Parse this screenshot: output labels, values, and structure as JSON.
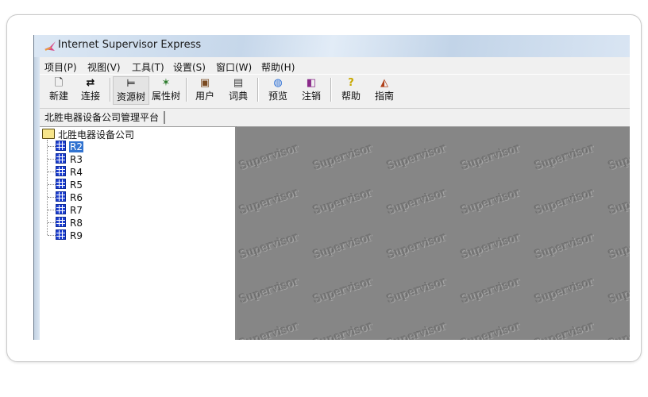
{
  "window": {
    "title": "Internet Supervisor Express"
  },
  "menu": [
    {
      "label": "项目(P)"
    },
    {
      "label": "视图(V)"
    },
    {
      "label": "工具(T)"
    },
    {
      "label": "设置(S)"
    },
    {
      "label": "窗口(W)"
    },
    {
      "label": "帮助(H)"
    }
  ],
  "toolbar": [
    {
      "label": "新建",
      "icon": "new-document-icon",
      "glyph": "🗋"
    },
    {
      "label": "连接",
      "icon": "connect-icon",
      "glyph": "⇄"
    },
    {
      "label": "资源树",
      "icon": "resource-tree-icon",
      "glyph": "⊨"
    },
    {
      "label": "属性树",
      "icon": "property-tree-icon",
      "glyph": "✶"
    },
    {
      "label": "用户",
      "icon": "user-icon",
      "glyph": "▣"
    },
    {
      "label": "词典",
      "icon": "dictionary-icon",
      "glyph": "▤"
    },
    {
      "label": "预览",
      "icon": "preview-icon",
      "glyph": "◍"
    },
    {
      "label": "注销",
      "icon": "logout-icon",
      "glyph": "◧"
    },
    {
      "label": "帮助",
      "icon": "help-icon",
      "glyph": "?"
    },
    {
      "label": "指南",
      "icon": "guide-icon",
      "glyph": "◭"
    }
  ],
  "tabs": [
    {
      "label": "北胜电器设备公司管理平台"
    }
  ],
  "tree": {
    "root": "北胜电器设备公司",
    "items": [
      {
        "label": "R2",
        "selected": true
      },
      {
        "label": "R3"
      },
      {
        "label": "R4"
      },
      {
        "label": "R5"
      },
      {
        "label": "R6"
      },
      {
        "label": "R7"
      },
      {
        "label": "R8"
      },
      {
        "label": "R9"
      }
    ]
  },
  "content": {
    "watermark": "Supervisor"
  },
  "colors": {
    "selection": "#3173d0",
    "content_bg": "#868686",
    "node_icon": "#1d3fd1"
  }
}
